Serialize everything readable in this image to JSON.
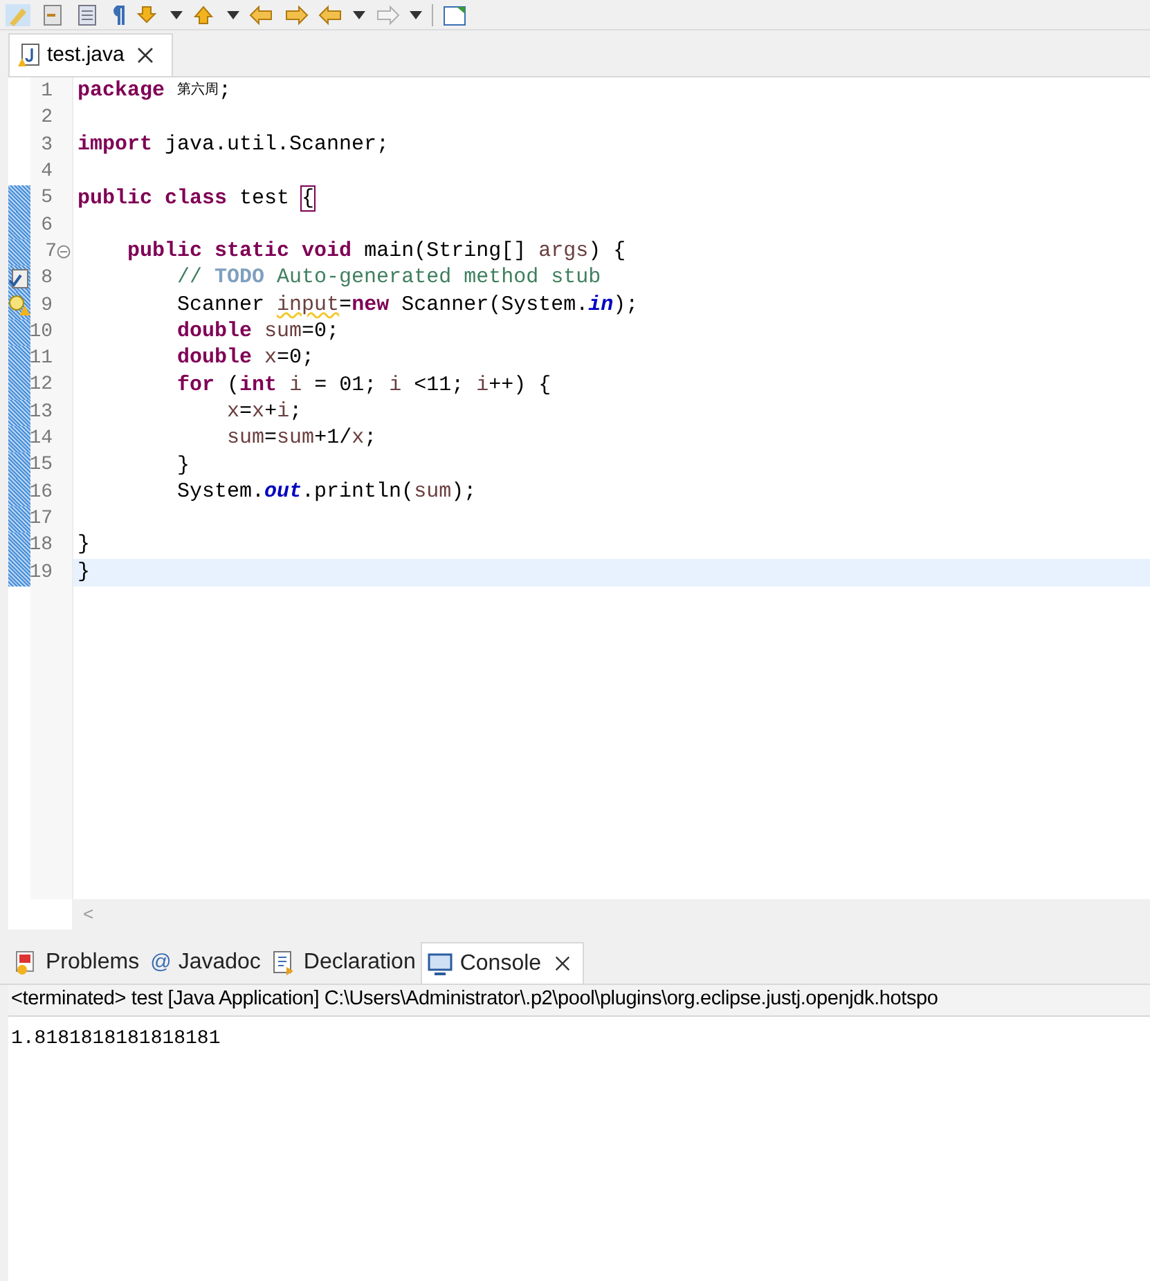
{
  "editor_tab": {
    "label": "test.java",
    "selected": true
  },
  "lines": [
    {
      "number": "1",
      "changed": false,
      "current": false,
      "tokens": [
        {
          "kind": "keyword",
          "text": "package "
        },
        {
          "kind": "cjk",
          "text": "第六周"
        },
        {
          "kind": "plain",
          "text": ";"
        }
      ]
    },
    {
      "number": "2",
      "changed": false,
      "current": false
    },
    {
      "number": "3",
      "changed": false,
      "current": false,
      "tokens": [
        {
          "kind": "keyword",
          "text": "import "
        },
        {
          "kind": "plain",
          "text": "java.util.Scanner;"
        }
      ]
    },
    {
      "number": "4",
      "changed": false,
      "current": false
    },
    {
      "number": "5",
      "changed": true,
      "current": false,
      "tokens": [
        {
          "kind": "keyword",
          "text": "public "
        },
        {
          "kind": "keyword",
          "text": "class "
        },
        {
          "kind": "plain",
          "text": "test "
        },
        {
          "kind": "bracket-match",
          "text": "{"
        }
      ]
    },
    {
      "number": "6",
      "changed": true,
      "current": false
    },
    {
      "number": "7",
      "changed": true,
      "current": false,
      "fold": true,
      "tokens": [
        {
          "kind": "keyword",
          "text": "    public "
        },
        {
          "kind": "keyword",
          "text": "static "
        },
        {
          "kind": "keyword",
          "text": "void "
        },
        {
          "kind": "plain",
          "text": "main(String[] "
        },
        {
          "kind": "local",
          "text": "args"
        },
        {
          "kind": "plain",
          "text": ") {"
        }
      ]
    },
    {
      "number": "8",
      "changed": true,
      "current": false,
      "task": true,
      "tokens": [
        {
          "kind": "comment",
          "text": "        // "
        },
        {
          "kind": "todo",
          "text": "TODO"
        },
        {
          "kind": "comment",
          "text": " Auto-generated method stub"
        }
      ]
    },
    {
      "number": "9",
      "changed": true,
      "current": false,
      "warning": true,
      "tokens": [
        {
          "kind": "plain",
          "text": "        Scanner "
        },
        {
          "kind": "local-warned",
          "text": "input"
        },
        {
          "kind": "plain",
          "text": "="
        },
        {
          "kind": "keyword",
          "text": "new"
        },
        {
          "kind": "plain",
          "text": " Scanner(System."
        },
        {
          "kind": "static-field",
          "text": "in"
        },
        {
          "kind": "plain",
          "text": ");"
        }
      ]
    },
    {
      "number": "10",
      "changed": true,
      "current": false,
      "tokens": [
        {
          "kind": "keyword",
          "text": "        double "
        },
        {
          "kind": "local",
          "text": "sum"
        },
        {
          "kind": "plain",
          "text": "=0;"
        }
      ]
    },
    {
      "number": "11",
      "changed": true,
      "current": false,
      "tokens": [
        {
          "kind": "keyword",
          "text": "        double "
        },
        {
          "kind": "local",
          "text": "x"
        },
        {
          "kind": "plain",
          "text": "=0;"
        }
      ]
    },
    {
      "number": "12",
      "changed": true,
      "current": false,
      "tokens": [
        {
          "kind": "keyword",
          "text": "        for "
        },
        {
          "kind": "plain",
          "text": "("
        },
        {
          "kind": "keyword",
          "text": "int "
        },
        {
          "kind": "local",
          "text": "i"
        },
        {
          "kind": "plain",
          "text": " = 01; "
        },
        {
          "kind": "local",
          "text": "i"
        },
        {
          "kind": "plain",
          "text": " <11; "
        },
        {
          "kind": "local",
          "text": "i"
        },
        {
          "kind": "plain",
          "text": "++) {"
        }
      ]
    },
    {
      "number": "13",
      "changed": true,
      "current": false,
      "tokens": [
        {
          "kind": "local",
          "text": "            x"
        },
        {
          "kind": "plain",
          "text": "="
        },
        {
          "kind": "local",
          "text": "x"
        },
        {
          "kind": "plain",
          "text": "+"
        },
        {
          "kind": "local",
          "text": "i"
        },
        {
          "kind": "plain",
          "text": ";"
        }
      ]
    },
    {
      "number": "14",
      "changed": true,
      "current": false,
      "tokens": [
        {
          "kind": "local",
          "text": "            sum"
        },
        {
          "kind": "plain",
          "text": "="
        },
        {
          "kind": "local",
          "text": "sum"
        },
        {
          "kind": "plain",
          "text": "+1/"
        },
        {
          "kind": "local",
          "text": "x"
        },
        {
          "kind": "plain",
          "text": ";"
        }
      ]
    },
    {
      "number": "15",
      "changed": true,
      "current": false,
      "tokens": [
        {
          "kind": "plain",
          "text": "        }"
        }
      ]
    },
    {
      "number": "16",
      "changed": true,
      "current": false,
      "tokens": [
        {
          "kind": "plain",
          "text": "        System."
        },
        {
          "kind": "static-field",
          "text": "out"
        },
        {
          "kind": "plain",
          "text": ".println("
        },
        {
          "kind": "local",
          "text": "sum"
        },
        {
          "kind": "plain",
          "text": ");"
        }
      ]
    },
    {
      "number": "17",
      "changed": true,
      "current": false
    },
    {
      "number": "18",
      "changed": true,
      "current": false,
      "tokens": [
        {
          "kind": "plain",
          "text": "}"
        }
      ]
    },
    {
      "number": "19",
      "changed": true,
      "current": true,
      "tokens": [
        {
          "kind": "plain",
          "text": "}"
        }
      ]
    }
  ],
  "scroll_left": "<",
  "panel_tabs": [
    {
      "label": "Problems",
      "kind": "problems",
      "selected": false
    },
    {
      "label": "Javadoc",
      "kind": "javadoc",
      "icon": "@",
      "selected": false
    },
    {
      "label": "Declaration",
      "kind": "declaration",
      "selected": false
    },
    {
      "label": "Console",
      "kind": "console",
      "selected": true
    }
  ],
  "console": {
    "header": "<terminated> test [Java Application] C:\\Users\\Administrator\\.p2\\pool\\plugins\\org.eclipse.justj.openjdk.hotspo",
    "output": "1.8181818181818181"
  }
}
